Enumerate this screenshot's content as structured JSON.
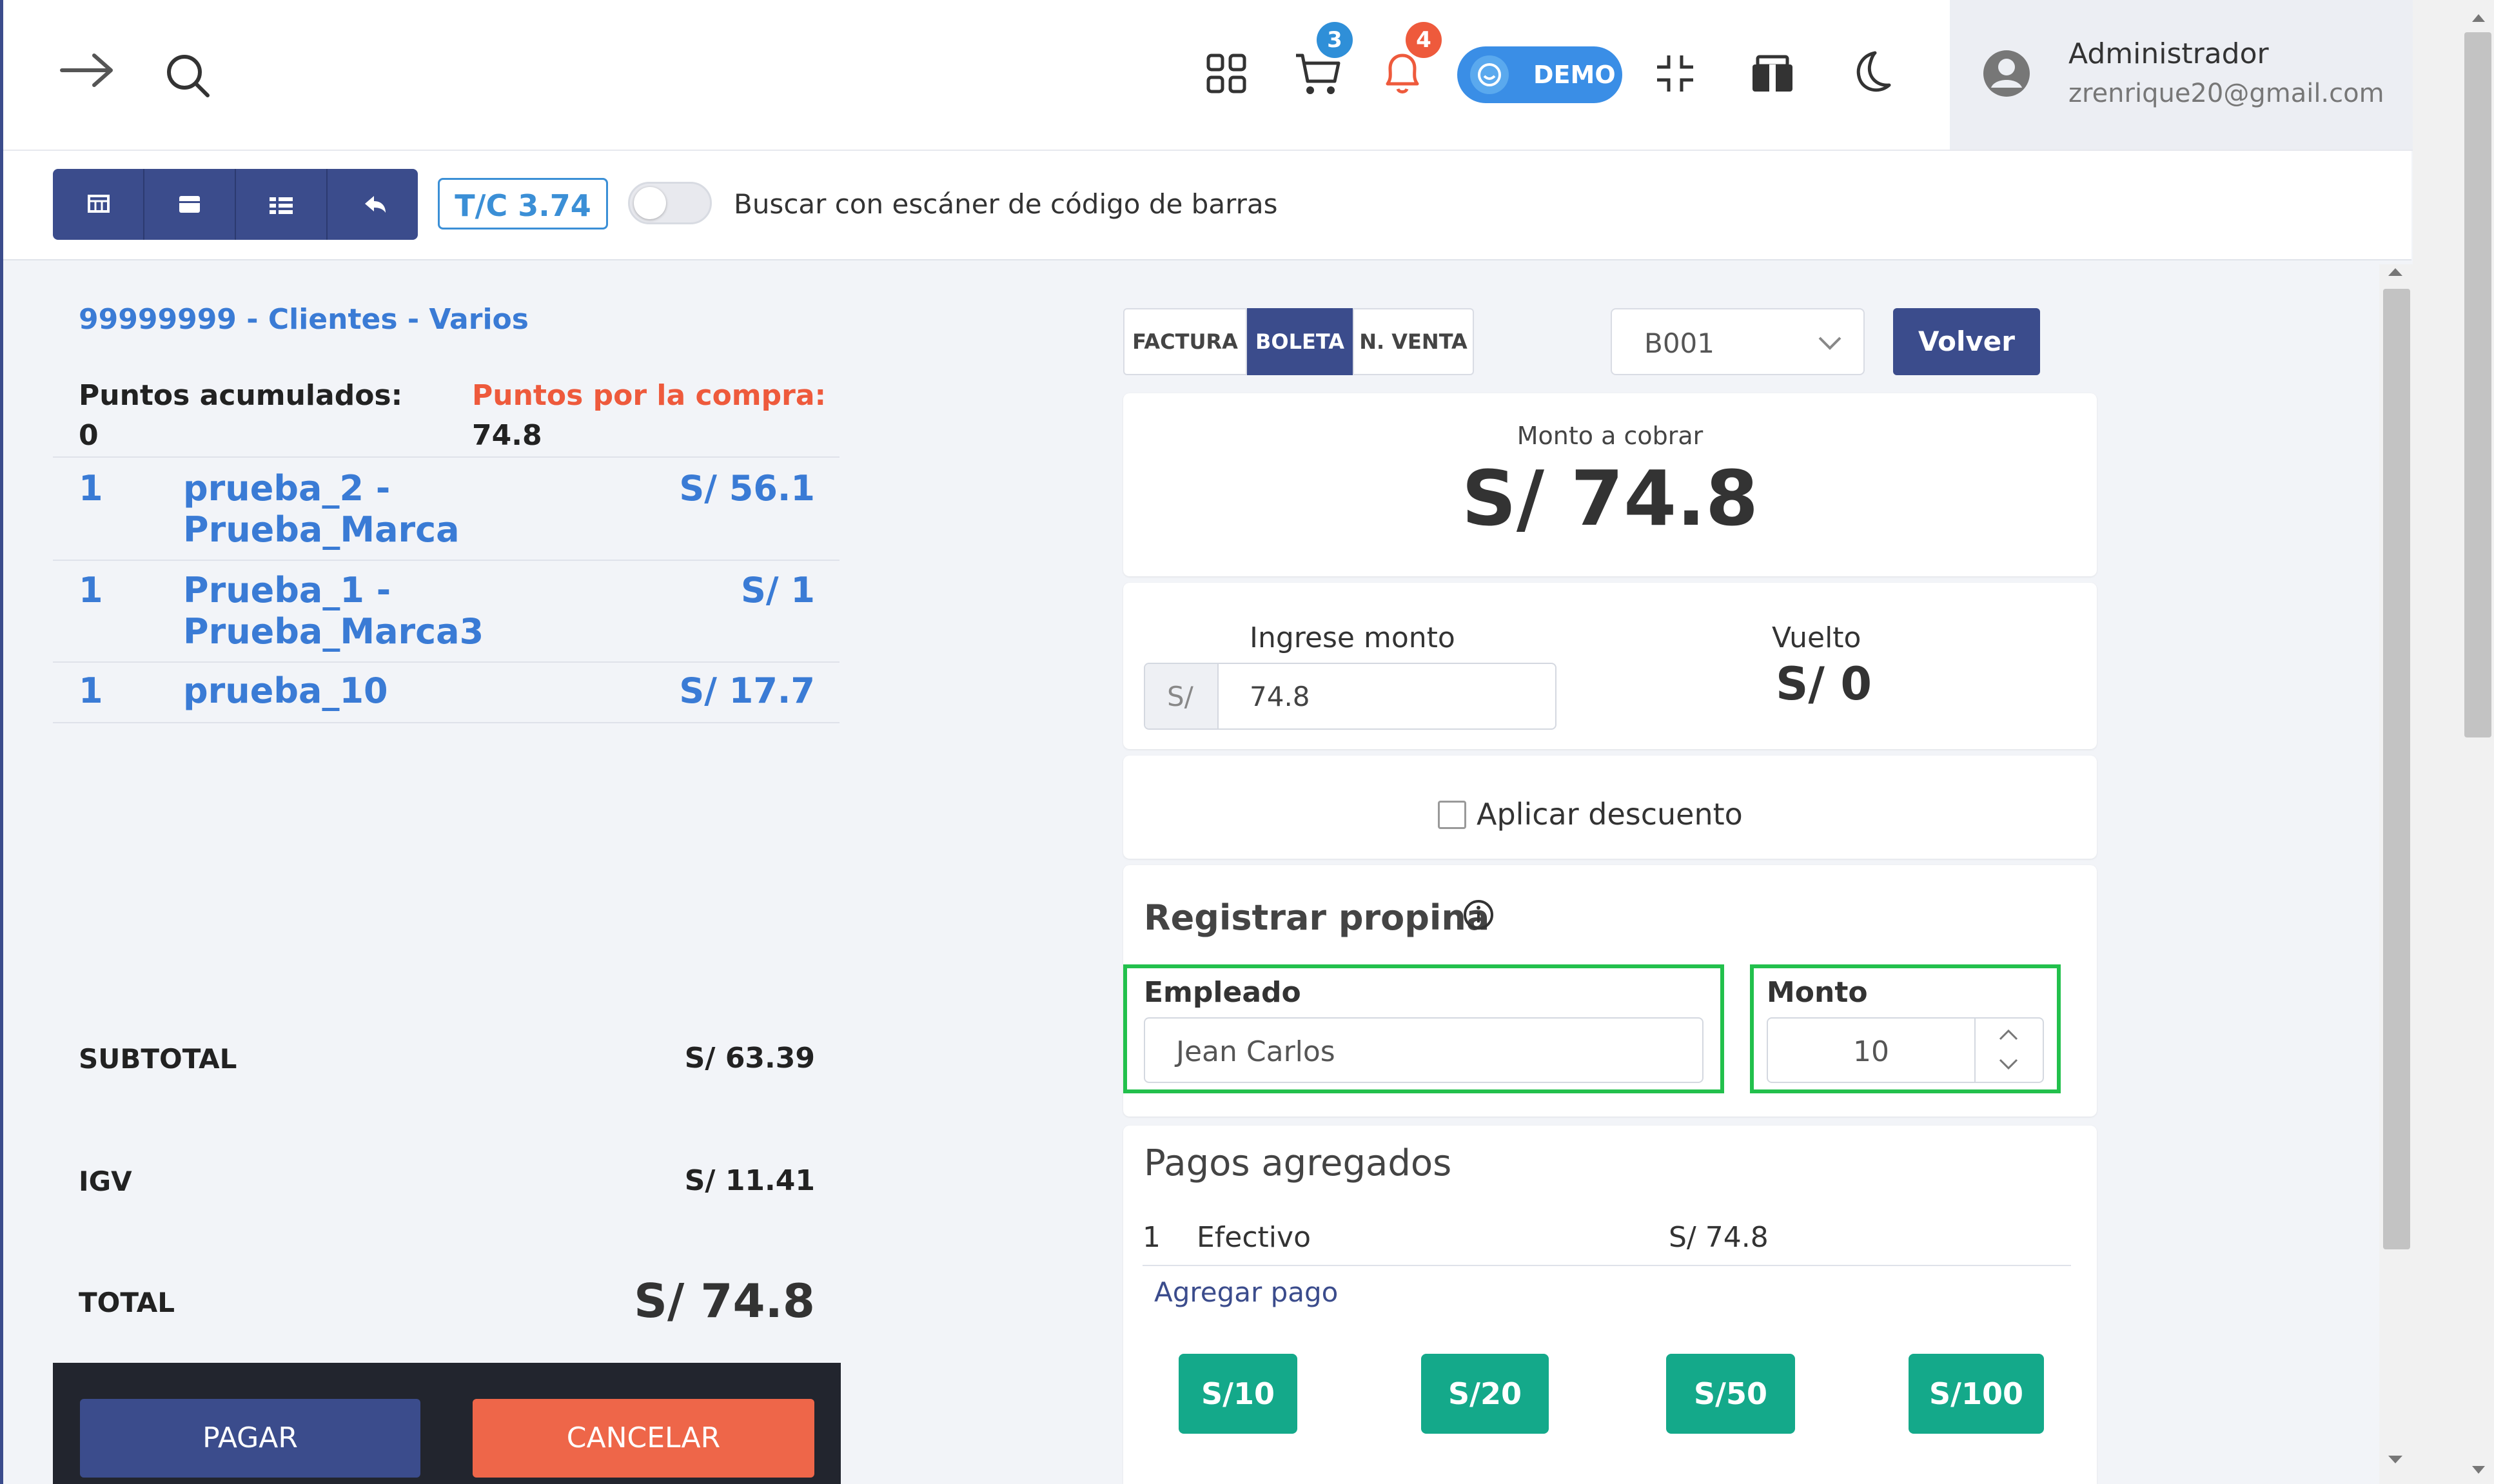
{
  "header": {
    "cart_count": "3",
    "notif_count": "4",
    "demo_label": "DEMO",
    "user_name": "Administrador",
    "user_email": "zrenrique20@gmail.com"
  },
  "toolbar": {
    "exchange_rate": "T/C 3.74",
    "barcode_label": "Buscar con escáner de código de barras"
  },
  "customer": {
    "name": "99999999 - Clientes - Varios",
    "points_label": "Puntos acumulados:",
    "points_value": "0",
    "purchase_points_label": "Puntos por la compra:",
    "purchase_points_value": "74.8"
  },
  "items": [
    {
      "qty": "1",
      "name1": "prueba_2 -",
      "name2": "Prueba_Marca",
      "price": "S/ 56.1"
    },
    {
      "qty": "1",
      "name1": "Prueba_1 -",
      "name2": "Prueba_Marca3",
      "price": "S/ 1"
    },
    {
      "qty": "1",
      "name1": "prueba_10",
      "name2": "",
      "price": "S/ 17.7"
    }
  ],
  "totals": {
    "subtotal_label": "SUBTOTAL",
    "subtotal": "S/ 63.39",
    "igv_label": "IGV",
    "igv": "S/ 11.41",
    "total_label": "TOTAL",
    "total": "S/ 74.8"
  },
  "actions": {
    "pay": "PAGAR",
    "cancel": "CANCELAR"
  },
  "doc_types": [
    "FACTURA",
    "BOLETA",
    "N. VENTA"
  ],
  "doc_type_selected": "BOLETA",
  "series": "B001",
  "back_label": "Volver",
  "amount_due_label": "Monto a cobrar",
  "amount_due": "S/ 74.8",
  "enter_amount_label": "Ingrese monto",
  "currency_prefix": "S/",
  "entered_amount": "74.8",
  "change_label": "Vuelto",
  "change_value": "S/ 0",
  "discount_label": "Aplicar descuento",
  "tip": {
    "title": "Registrar propina",
    "employee_label": "Empleado",
    "employee_value": "Jean Carlos",
    "amount_label": "Monto",
    "amount_value": "10"
  },
  "payments": {
    "title": "Pagos agregados",
    "rows": [
      {
        "n": "1",
        "method": "Efectivo",
        "amount": "S/ 74.8"
      }
    ],
    "add_label": "Agregar pago"
  },
  "quick_amounts": [
    "S/10",
    "S/20",
    "S/50",
    "S/100"
  ],
  "colors": {
    "primary": "#3b4c8c",
    "link": "#3a7bd5",
    "accent_red": "#ee6649",
    "teal": "#14a98a",
    "highlight": "#22c04c"
  }
}
